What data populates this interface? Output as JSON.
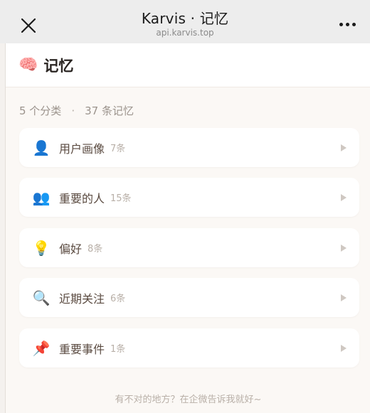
{
  "topbar": {
    "title": "Karvis · 记忆",
    "subtitle": "api.karvis.top"
  },
  "header": {
    "icon": "🧠",
    "title": "记忆"
  },
  "stats": {
    "categories": "5 个分类",
    "separator": "·",
    "memories": "37 条记忆"
  },
  "categories": [
    {
      "icon": "👤",
      "icon_name": "user-bust-icon",
      "label": "用户画像",
      "count": "7条"
    },
    {
      "icon": "👥",
      "icon_name": "people-icon",
      "label": "重要的人",
      "count": "15条"
    },
    {
      "icon": "💡",
      "icon_name": "lightbulb-icon",
      "label": "偏好",
      "count": "8条"
    },
    {
      "icon": "🔍",
      "icon_name": "magnifier-icon",
      "label": "近期关注",
      "count": "6条"
    },
    {
      "icon": "📌",
      "icon_name": "pushpin-icon",
      "label": "重要事件",
      "count": "1条"
    }
  ],
  "footer": {
    "text": "有不对的地方？在企微告诉我就好~"
  }
}
